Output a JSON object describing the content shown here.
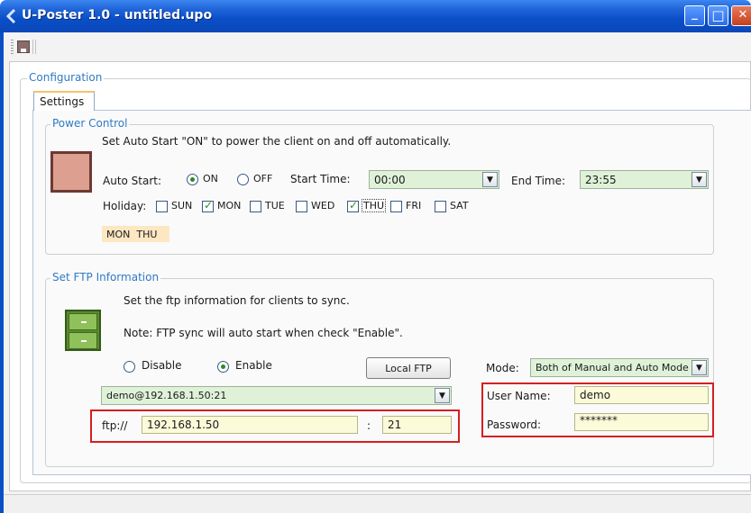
{
  "window": {
    "title": "U-Poster 1.0 - untitled.upo",
    "min_glyph": "_",
    "max_glyph": "□",
    "close_glyph": "✕"
  },
  "configuration": {
    "legend": "Configuration",
    "tab_label": "Settings"
  },
  "power": {
    "legend": "Power Control",
    "description": "Set Auto Start \"ON\" to power the client on and off automatically.",
    "auto_start_label": "Auto Start:",
    "on_label": "ON",
    "off_label": "OFF",
    "auto_start_value": "ON",
    "start_time_label": "Start Time:",
    "start_time": "00:00",
    "end_time_label": "End Time:",
    "end_time": "23:55",
    "holiday_label": "Holiday:",
    "days": [
      {
        "label": "SUN",
        "checked": false
      },
      {
        "label": "MON",
        "checked": true
      },
      {
        "label": "TUE",
        "checked": false
      },
      {
        "label": "WED",
        "checked": false
      },
      {
        "label": "THU",
        "checked": true
      },
      {
        "label": "FRI",
        "checked": false
      },
      {
        "label": "SAT",
        "checked": false
      }
    ],
    "holiday_summary": "MON  THU"
  },
  "ftp": {
    "legend": "Set FTP Information",
    "description": "Set the ftp information for clients to sync.",
    "note": "Note: FTP sync will auto start when check \"Enable\".",
    "disable_label": "Disable",
    "enable_label": "Enable",
    "selected": "Enable",
    "local_ftp_button": "Local FTP",
    "mode_label": "Mode:",
    "mode_value": "Both of Manual and Auto Mode",
    "server_value": "demo@192.168.1.50:21",
    "protocol_label": "ftp://",
    "host": "192.168.1.50",
    "port_separator": ":",
    "port": "21",
    "username_label": "User Name:",
    "username": "demo",
    "password_label": "Password:",
    "password": "*******"
  },
  "icons": {
    "dropdown_arrow": "▼"
  },
  "colors": {
    "titlebar": "#0a4ec7",
    "legend": "#2e7bc4",
    "highlight_red": "#d42020",
    "combo_bg": "#dff2d8",
    "textbox_bg": "#fbfbd9"
  }
}
